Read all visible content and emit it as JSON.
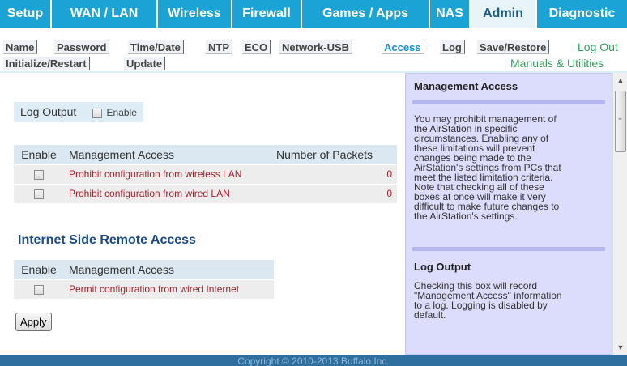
{
  "topnav": {
    "tabs": [
      {
        "label": "Setup"
      },
      {
        "label": "WAN / LAN"
      },
      {
        "label": "Wireless"
      },
      {
        "label": "Firewall"
      },
      {
        "label": "Games / Apps"
      },
      {
        "label": "NAS"
      },
      {
        "label": "Admin",
        "active": true
      },
      {
        "label": "Diagnostic"
      }
    ]
  },
  "subnav": {
    "links": [
      {
        "label": "Name"
      },
      {
        "label": "Password"
      },
      {
        "label": "Time/Date"
      },
      {
        "label": "NTP"
      },
      {
        "label": "ECO"
      },
      {
        "label": "Network-USB"
      },
      {
        "label": "Access",
        "active": true
      },
      {
        "label": "Log"
      },
      {
        "label": "Save/Restore"
      },
      {
        "label": "Initialize/Restart"
      },
      {
        "label": "Update"
      }
    ],
    "logout": "Log Out",
    "manuals": "Manuals & Utilities"
  },
  "log_output": {
    "label": "Log Output",
    "enable_label": "Enable",
    "enabled": false
  },
  "local_table": {
    "headers": [
      "Enable",
      "Management Access",
      "Number of Packets"
    ],
    "rows": [
      {
        "access": "Prohibit configuration from wireless LAN",
        "packets": "0",
        "checked": false
      },
      {
        "access": "Prohibit configuration from wired LAN",
        "packets": "0",
        "checked": false
      }
    ]
  },
  "remote": {
    "title": "Internet Side Remote Access",
    "headers": [
      "Enable",
      "Management Access"
    ],
    "rows": [
      {
        "access": "Permit configuration from wired Internet",
        "checked": false
      }
    ]
  },
  "apply_label": "Apply",
  "help": {
    "sections": [
      {
        "title": "Management Access",
        "lines": [
          "You may prohibit management of",
          "the AirStation in specific",
          "circumstances. Enabling any of",
          "these limitations will prevent",
          "changes being made to the",
          "AirStation's settings from PCs that",
          "meet the listed limitation criteria.",
          "Note that checking all of these",
          "boxes at once will make it very",
          "difficult to make future changes to",
          "the AirStation's settings."
        ]
      },
      {
        "title": "Log Output",
        "lines": [
          "Checking this box will record",
          "\"Management Access\" information",
          "to a log. Logging is disabled by",
          "default."
        ]
      }
    ]
  },
  "footer": "Copyright © 2010-2013 Buffalo Inc."
}
